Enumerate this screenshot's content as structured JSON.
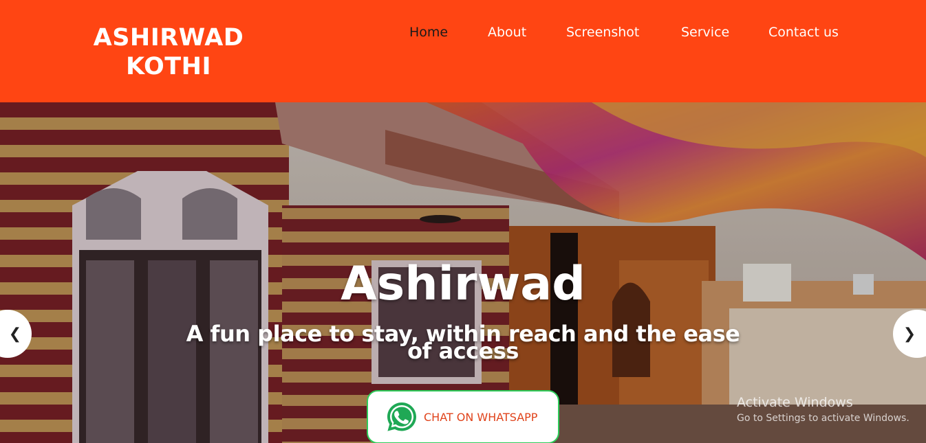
{
  "brand": {
    "logo_line1": "ASHIRWAD",
    "logo_line2": "KOTHI",
    "header_color": "#ff4513"
  },
  "nav": [
    {
      "label": "Home",
      "active": true
    },
    {
      "label": "About",
      "active": false
    },
    {
      "label": "Screenshot",
      "active": false
    },
    {
      "label": "Service",
      "active": false
    },
    {
      "label": "Contact us",
      "active": false
    }
  ],
  "hero": {
    "title": "Ashirwad",
    "subtitle": "A fun place to stay, within reach and the ease of access",
    "cta_label": "CHAT ON WHATSAPP",
    "cta_icon": "whatsapp-icon",
    "prev_icon": "chevron-left-icon",
    "next_icon": "chevron-right-icon"
  },
  "watermark": {
    "line1": "Activate Windows",
    "line2": "Go to Settings to activate Windows."
  }
}
